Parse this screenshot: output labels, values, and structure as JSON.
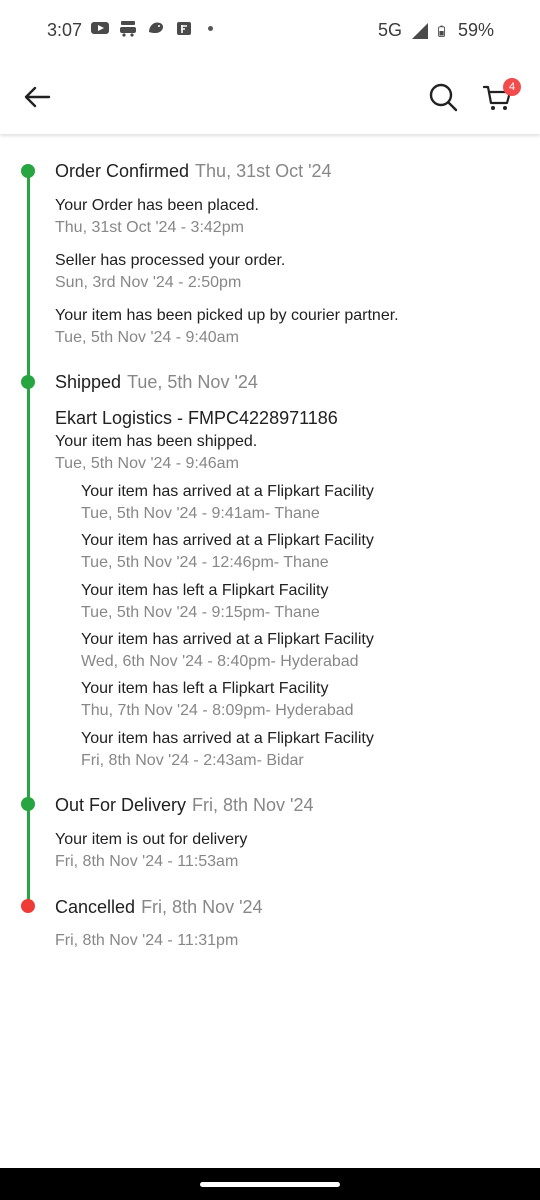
{
  "status_bar": {
    "time": "3:07",
    "network": "5G",
    "battery": "59%"
  },
  "app_bar": {
    "cart_count": "4"
  },
  "timeline": {
    "stages": [
      {
        "title": "Order Confirmed",
        "date": "Thu, 31st Oct '24",
        "status": "done",
        "events": [
          {
            "text": "Your Order has been placed.",
            "time": "Thu, 31st Oct '24 - 3:42pm"
          },
          {
            "text": "Seller has processed your order.",
            "time": "Sun, 3rd Nov '24 - 2:50pm"
          },
          {
            "text": "Your item has been picked up by courier partner.",
            "time": "Tue, 5th Nov '24 - 9:40am"
          }
        ]
      },
      {
        "title": "Shipped",
        "date": "Tue, 5th Nov '24",
        "status": "done",
        "courier": "Ekart Logistics - FMPC4228971186",
        "events": [
          {
            "text": "Your item has been shipped.",
            "time": "Tue, 5th Nov '24 - 9:46am"
          }
        ],
        "sub_events": [
          {
            "text": "Your item has arrived at a Flipkart Facility",
            "time": "Tue, 5th Nov '24 - 9:41am- Thane"
          },
          {
            "text": "Your item has arrived at a Flipkart Facility",
            "time": "Tue, 5th Nov '24 - 12:46pm- Thane"
          },
          {
            "text": "Your item has left a Flipkart Facility",
            "time": "Tue, 5th Nov '24 - 9:15pm- Thane"
          },
          {
            "text": "Your item has arrived at a Flipkart Facility",
            "time": "Wed, 6th Nov '24 - 8:40pm- Hyderabad"
          },
          {
            "text": "Your item has left a Flipkart Facility",
            "time": "Thu, 7th Nov '24 - 8:09pm- Hyderabad"
          },
          {
            "text": "Your item has arrived at a Flipkart Facility",
            "time": "Fri, 8th Nov '24 - 2:43am- Bidar"
          }
        ]
      },
      {
        "title": "Out For Delivery",
        "date": "Fri, 8th Nov '24",
        "status": "done",
        "events": [
          {
            "text": "Your item is out for delivery",
            "time": "Fri, 8th Nov '24 - 11:53am"
          }
        ]
      },
      {
        "title": "Cancelled",
        "date": "Fri, 8th Nov '24",
        "status": "cancelled",
        "events": [
          {
            "text": "",
            "time": "Fri, 8th Nov '24 - 11:31pm"
          }
        ]
      }
    ]
  },
  "colors": {
    "timeline_green": "#26a541",
    "cancel_red": "#ef3b36",
    "badge_red": "#f24b4b",
    "muted_text": "#878787"
  }
}
